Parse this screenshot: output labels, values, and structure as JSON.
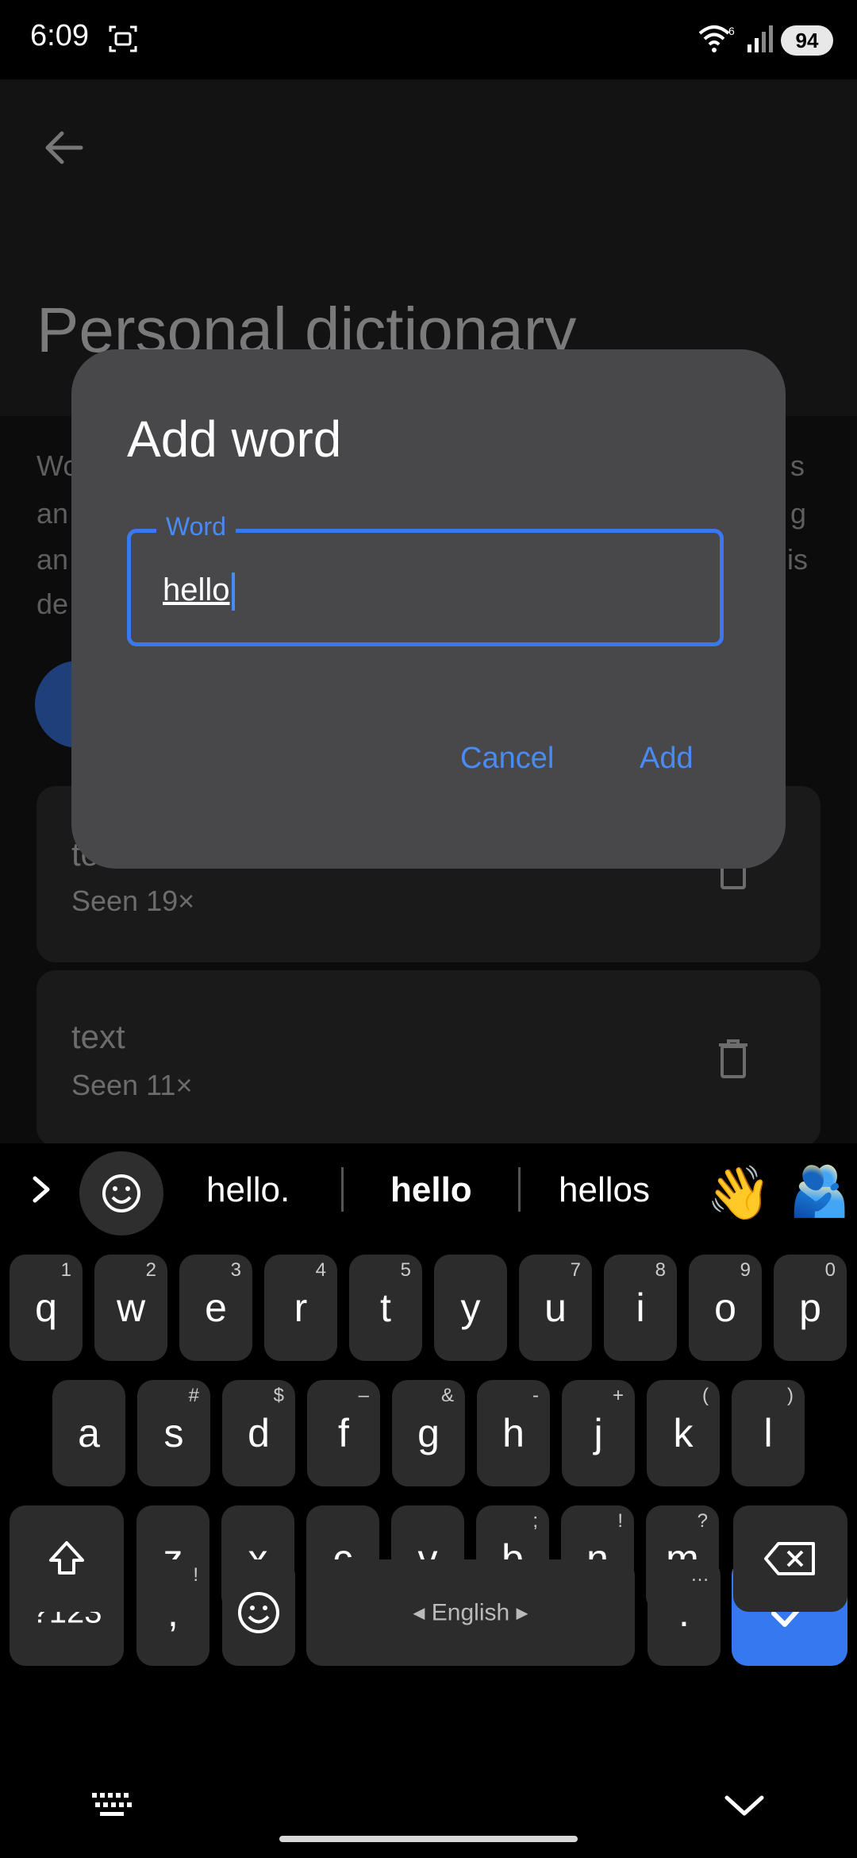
{
  "status_bar": {
    "time": "6:09",
    "battery": "94",
    "wifi_badge": "6"
  },
  "page": {
    "title": "Personal dictionary",
    "description_left": [
      "Wo",
      "an",
      "an",
      "de"
    ],
    "description_right": [
      "s",
      "g",
      "is"
    ],
    "words": [
      {
        "title": "to",
        "seen": "Seen 19×"
      },
      {
        "title": "text",
        "seen": "Seen 11×"
      }
    ]
  },
  "dialog": {
    "title": "Add word",
    "field_label": "Word",
    "field_value": "hello",
    "cancel_label": "Cancel",
    "add_label": "Add"
  },
  "suggestions": {
    "items": [
      "hello.",
      "hello",
      "hellos"
    ],
    "emojis": [
      "👋",
      "🫂"
    ]
  },
  "keyboard": {
    "row1": [
      [
        "q",
        "1"
      ],
      [
        "w",
        "2"
      ],
      [
        "e",
        "3"
      ],
      [
        "r",
        "4"
      ],
      [
        "t",
        "5"
      ],
      [
        "y",
        ""
      ],
      [
        "u",
        "7"
      ],
      [
        "i",
        "8"
      ],
      [
        "o",
        "9"
      ],
      [
        "p",
        "0"
      ]
    ],
    "row2": [
      [
        "a",
        ""
      ],
      [
        "s",
        "#"
      ],
      [
        "d",
        "$"
      ],
      [
        "f",
        "–"
      ],
      [
        "g",
        "&"
      ],
      [
        "h",
        "-"
      ],
      [
        "j",
        "+"
      ],
      [
        "k",
        "("
      ],
      [
        "l",
        ")"
      ]
    ],
    "row3": [
      [
        "z",
        ""
      ],
      [
        "x",
        ""
      ],
      [
        "c",
        ""
      ],
      [
        "v",
        ""
      ],
      [
        "b",
        ";"
      ],
      [
        "n",
        "!"
      ],
      [
        "m",
        "?"
      ]
    ],
    "symbols_label": "?123",
    "comma_label": ",",
    "comma_hint": "!",
    "space_label": "English",
    "period_label": ".",
    "period_hint": "…"
  },
  "colors": {
    "accent": "#4a8af4",
    "dialog_bg": "#48484b",
    "enter_key": "#3578f0"
  }
}
